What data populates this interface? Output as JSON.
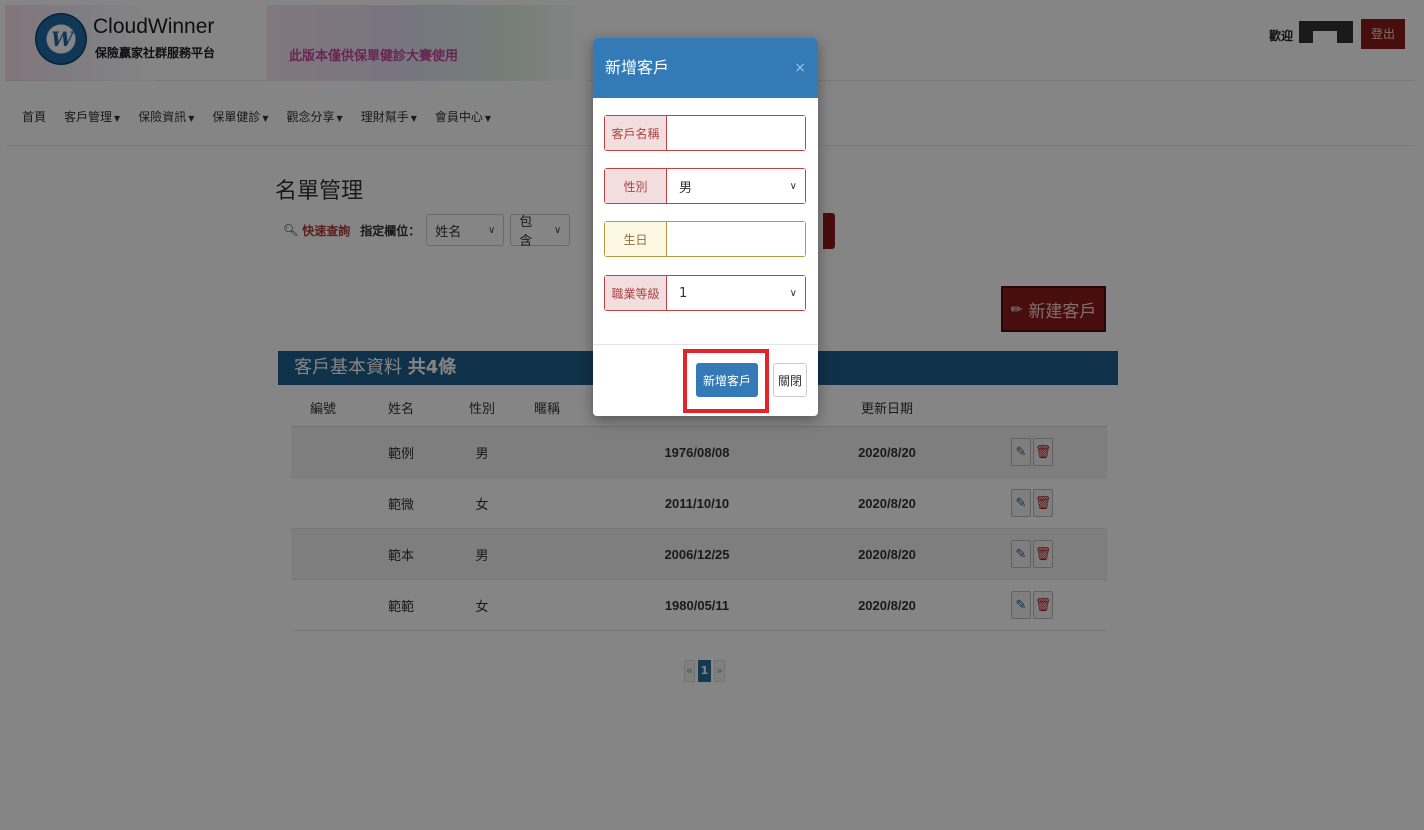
{
  "header": {
    "brand_name": "CloudWinner",
    "brand_sub": "保險贏家社群服務平台",
    "banner_text": "此版本僅供保單健診大賽使用",
    "welcome": "歡迎",
    "logout": "登出"
  },
  "nav": {
    "items": [
      {
        "label": "首頁",
        "caret": false
      },
      {
        "label": "客戶管理",
        "caret": true
      },
      {
        "label": "保險資訊",
        "caret": true
      },
      {
        "label": "保單健診",
        "caret": true
      },
      {
        "label": "觀念分享",
        "caret": true
      },
      {
        "label": "理財幫手",
        "caret": true
      },
      {
        "label": "會員中心",
        "caret": true
      }
    ]
  },
  "content": {
    "title": "名單管理",
    "quick_search": "快速查詢",
    "field_label": "指定欄位：",
    "field_select": "姓名",
    "match_select": "包含",
    "new_button": "新建客戶"
  },
  "panel": {
    "title": "客戶基本資料",
    "count": "共4條"
  },
  "table": {
    "headers": [
      "編號",
      "姓名",
      "性別",
      "暱稱",
      "更新日期"
    ],
    "rows": [
      {
        "id": "",
        "name": "範例",
        "gender": "男",
        "nickname": "",
        "birthday": "1976/08/08",
        "updated": "2020/8/20"
      },
      {
        "id": "",
        "name": "範微",
        "gender": "女",
        "nickname": "",
        "birthday": "2011/10/10",
        "updated": "2020/8/20"
      },
      {
        "id": "",
        "name": "範本",
        "gender": "男",
        "nickname": "",
        "birthday": "2006/12/25",
        "updated": "2020/8/20"
      },
      {
        "id": "",
        "name": "範範",
        "gender": "女",
        "nickname": "",
        "birthday": "1980/05/11",
        "updated": "2020/8/20"
      }
    ]
  },
  "pager": {
    "prev": "«",
    "current": "1",
    "next": "»"
  },
  "modal": {
    "title": "新增客戶",
    "close_x": "×",
    "fields": {
      "name_label": "客戶名稱",
      "name_value": "",
      "gender_label": "性別",
      "gender_value": "男",
      "birthday_label": "生日",
      "birthday_value": "",
      "job_label": "職業等級",
      "job_value": "1"
    },
    "submit": "新增客戶",
    "close": "關閉"
  },
  "colors": {
    "primary": "#337ab7",
    "brand_red": "#8a1c1c",
    "panel_blue": "#1f5e8e",
    "highlight": "#e3242b"
  }
}
